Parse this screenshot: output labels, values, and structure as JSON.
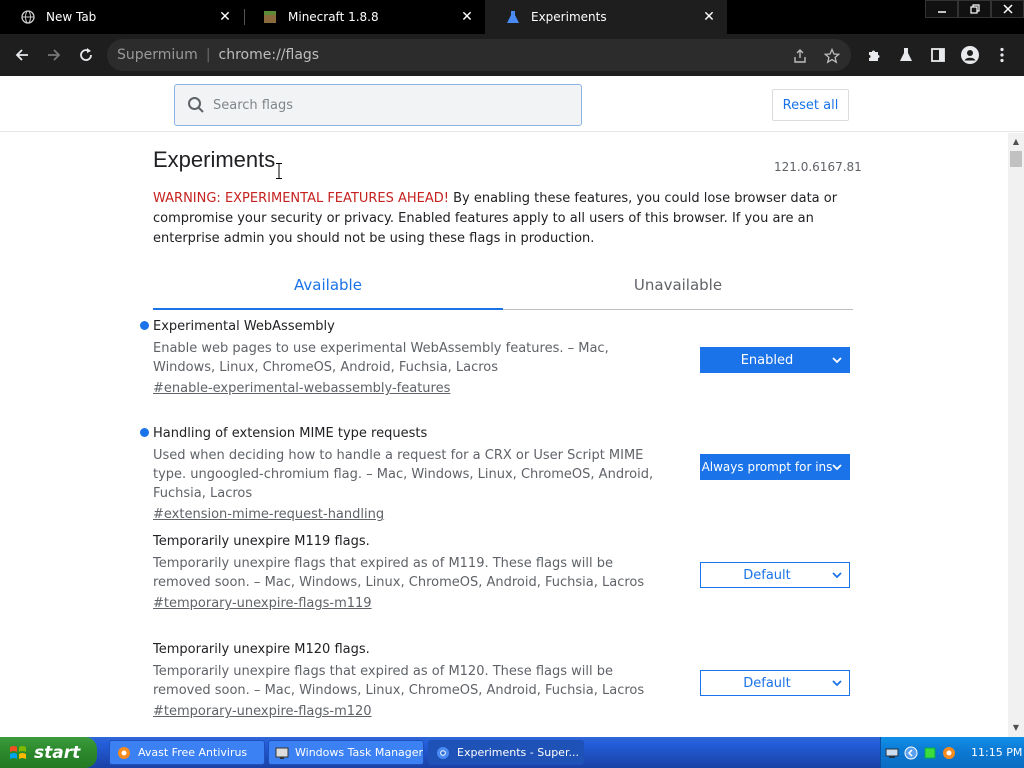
{
  "tabs": [
    {
      "title": "New Tab",
      "active": false
    },
    {
      "title": "Minecraft 1.8.8",
      "active": false
    },
    {
      "title": "Experiments",
      "active": true
    }
  ],
  "window_controls": {
    "minimize": "minimize",
    "restore": "restore",
    "close": "close"
  },
  "omnibox": {
    "origin": "Supermium",
    "path": "chrome://flags"
  },
  "search": {
    "placeholder": "Search flags"
  },
  "reset_label": "Reset all",
  "page": {
    "title": "Experiments",
    "version": "121.0.6167.81",
    "warning_red": "WARNING: EXPERIMENTAL FEATURES AHEAD!",
    "warning_text": " By enabling these features, you could lose browser data or compromise your security or privacy. Enabled features apply to all users of this browser. If you are an enterprise admin you should not be using these flags in production."
  },
  "page_tabs": {
    "available": "Available",
    "unavailable": "Unavailable"
  },
  "flags": [
    {
      "name": "Experimental WebAssembly",
      "description": "Enable web pages to use experimental WebAssembly features. – Mac, Windows, Linux, ChromeOS, Android, Fuchsia, Lacros",
      "link": "#enable-experimental-webassembly-features",
      "value": "Enabled",
      "modified": true
    },
    {
      "name": "Handling of extension MIME type requests",
      "description": "Used when deciding how to handle a request for a CRX or User Script MIME type. ungoogled-chromium flag. – Mac, Windows, Linux, ChromeOS, Android, Fuchsia, Lacros",
      "link": "#extension-mime-request-handling",
      "value": "Always prompt for ins",
      "modified": true
    },
    {
      "name": "Temporarily unexpire M119 flags.",
      "description": "Temporarily unexpire flags that expired as of M119. These flags will be removed soon. – Mac, Windows, Linux, ChromeOS, Android, Fuchsia, Lacros",
      "link": "#temporary-unexpire-flags-m119",
      "value": "Default",
      "modified": false
    },
    {
      "name": "Temporarily unexpire M120 flags.",
      "description": "Temporarily unexpire flags that expired as of M120. These flags will be removed soon. – Mac, Windows, Linux, ChromeOS, Android, Fuchsia, Lacros",
      "link": "#temporary-unexpire-flags-m120",
      "value": "Default",
      "modified": false
    }
  ],
  "taskbar": {
    "start_label": "start",
    "tasks": [
      {
        "label": "Avast Free Antivirus"
      },
      {
        "label": "Windows Task Manager"
      },
      {
        "label": "Experiments - Super..."
      }
    ],
    "clock": "11:15 PM"
  },
  "colors": {
    "accent": "#1a73e8",
    "warning": "#c5221f",
    "taskbar": "#245edb",
    "start": "#2e8b2e"
  }
}
